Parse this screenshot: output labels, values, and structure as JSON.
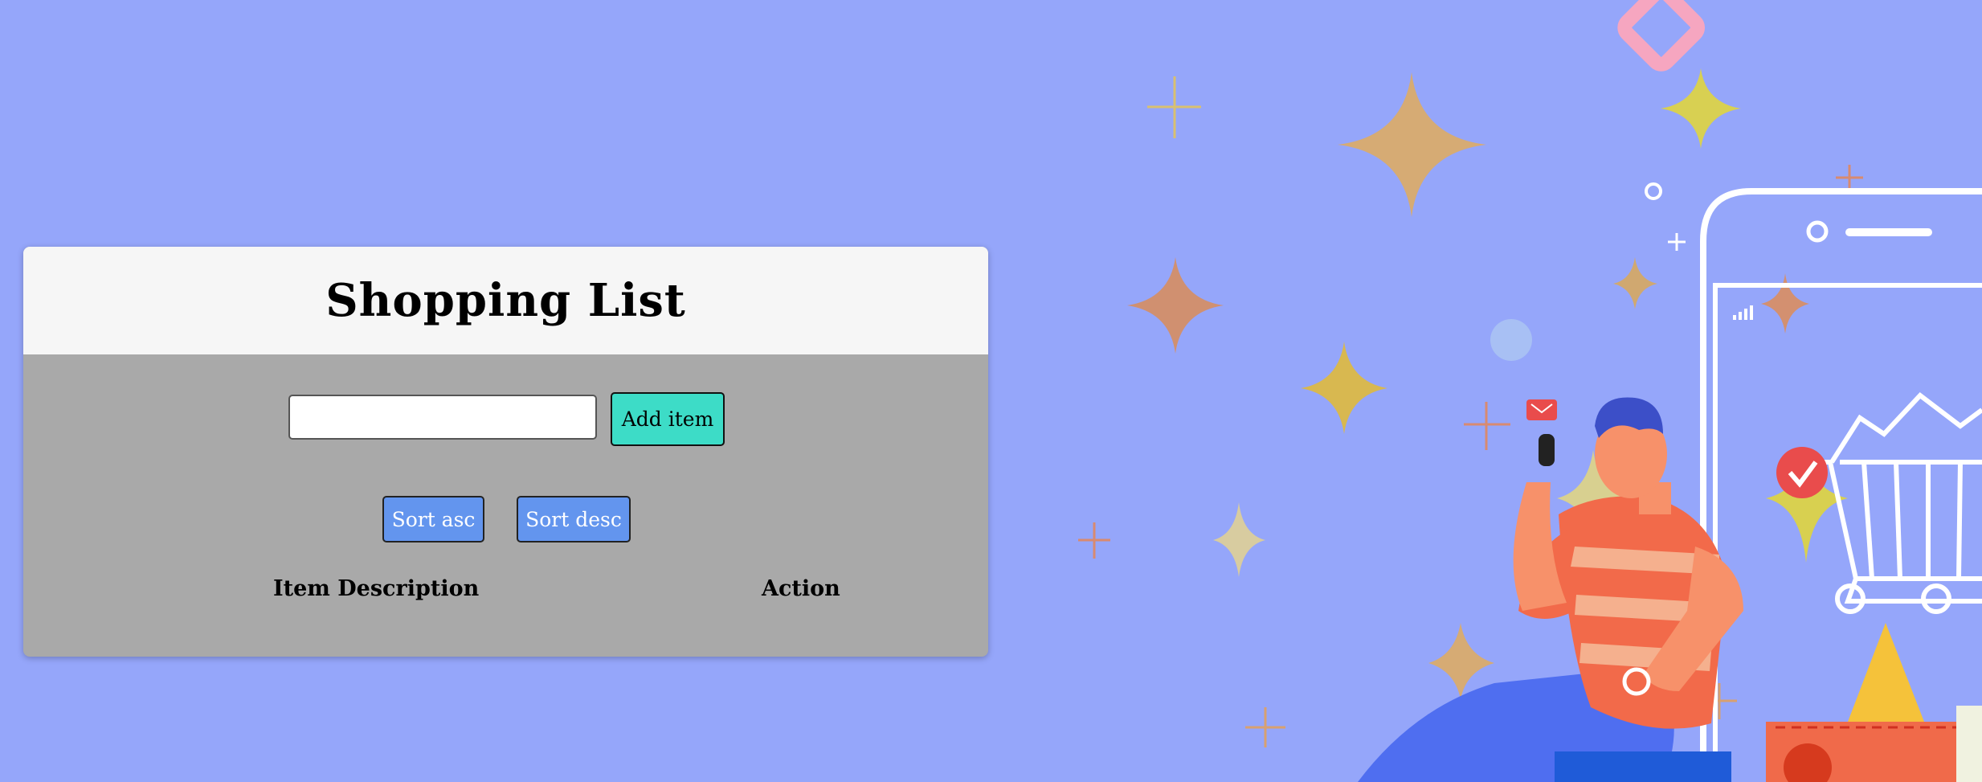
{
  "card": {
    "title": "Shopping List",
    "input_value": "",
    "add_label": "Add item",
    "sort_asc_label": "Sort asc",
    "sort_desc_label": "Sort desc",
    "columns": [
      "Item Description",
      "Action"
    ]
  },
  "colors": {
    "background": "#95a6fa",
    "header_bg": "#f6f6f6",
    "body_bg": "#a9a9a9",
    "add_button": "#3ddcc7",
    "sort_button": "#6395ee"
  }
}
